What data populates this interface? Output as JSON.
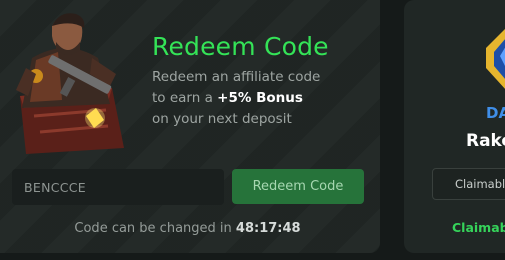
{
  "redeem": {
    "title": "Redeem Code",
    "desc_line1": "Redeem an affiliate code",
    "desc_line2_prefix": "to earn a ",
    "bonus": "+5% Bonus",
    "desc_line3": "on your next deposit",
    "code_value": "BENCCCE",
    "button_label": "Redeem Code",
    "cooldown_prefix": "Code can be changed in",
    "cooldown_time": "48:17:48"
  },
  "side_card": {
    "label": "DA",
    "subtitle": "Rake",
    "box_text": "Claimable",
    "status": "Claimab"
  },
  "colors": {
    "accent_green": "#34e357",
    "button_bg": "#26733a",
    "blue": "#3f8ee8"
  }
}
